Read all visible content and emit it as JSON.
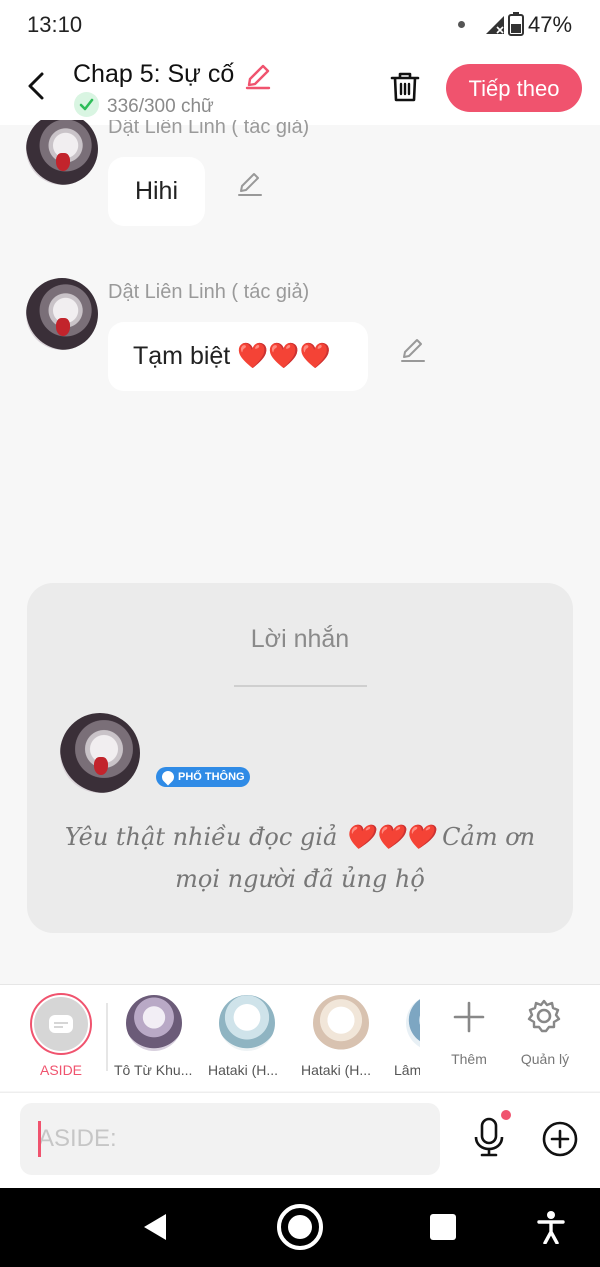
{
  "status_bar": {
    "time": "13:10",
    "battery": "47%"
  },
  "header": {
    "title": "Chap 5: Sự cố",
    "word_count": "336/300 chữ",
    "next_button": "Tiếp theo"
  },
  "messages": [
    {
      "author": "Dật Liên Linh ( tác giả)",
      "text": "Hihi"
    },
    {
      "author": "Dật Liên Linh ( tác giả)",
      "text": "Tạm biệt ❤️❤️❤️"
    }
  ],
  "note_card": {
    "title": "Lời nhắn",
    "tier_badge": "PHỔ THÔNG",
    "quote": "Yêu thật nhiều đọc giả ❤️❤️❤️ Cảm ơn mọi người đã ủng hộ"
  },
  "character_bar": {
    "aside_label": "ASIDE",
    "characters": [
      "Tô Từ Khu...",
      "Hataki (H...",
      "Hataki (H...",
      "Lâm"
    ],
    "add_label": "Thêm",
    "manage_label": "Quản lý"
  },
  "composer": {
    "placeholder": "ASIDE:"
  },
  "colors": {
    "accent": "#f0536e",
    "badge_blue": "#2f8be6",
    "success_green": "#2ebd59"
  }
}
